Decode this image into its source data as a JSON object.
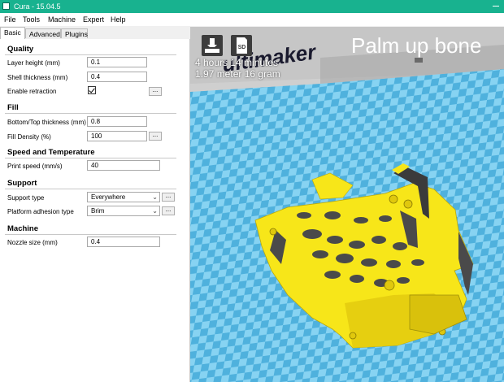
{
  "window": {
    "title": "Cura - 15.04.5"
  },
  "menu": [
    "File",
    "Tools",
    "Machine",
    "Expert",
    "Help"
  ],
  "tabs": [
    "Basic",
    "Advanced",
    "Plugins"
  ],
  "quality": {
    "title": "Quality",
    "layer_height_label": "Layer height (mm)",
    "layer_height": "0.1",
    "shell_thickness_label": "Shell thickness (mm)",
    "shell_thickness": "0.4",
    "retraction_label": "Enable retraction",
    "retraction_enabled": true
  },
  "fill": {
    "title": "Fill",
    "bottom_top_label": "Bottom/Top thickness (mm)",
    "bottom_top": "0.8",
    "density_label": "Fill Density (%)",
    "density": "100"
  },
  "speed": {
    "title": "Speed and Temperature",
    "print_speed_label": "Print speed (mm/s)",
    "print_speed": "40"
  },
  "support": {
    "title": "Support",
    "support_type_label": "Support type",
    "support_type": "Everywhere",
    "adhesion_label": "Platform adhesion type",
    "adhesion": "Brim"
  },
  "machine": {
    "title": "Machine",
    "nozzle_label": "Nozzle size (mm)",
    "nozzle": "0.4"
  },
  "more_label": "...",
  "viewport": {
    "print_time": "4 hours 14 minutes",
    "print_amount": "1.97 meter 16 gram",
    "model_name": "Palm up bone",
    "logo_text": "ultimaker",
    "sd_label": "SD"
  },
  "colors": {
    "titlebar": "#18b28f",
    "plate_light": "#87d3f2",
    "plate_dark": "#4fb1dd",
    "model": "#f7e619"
  }
}
